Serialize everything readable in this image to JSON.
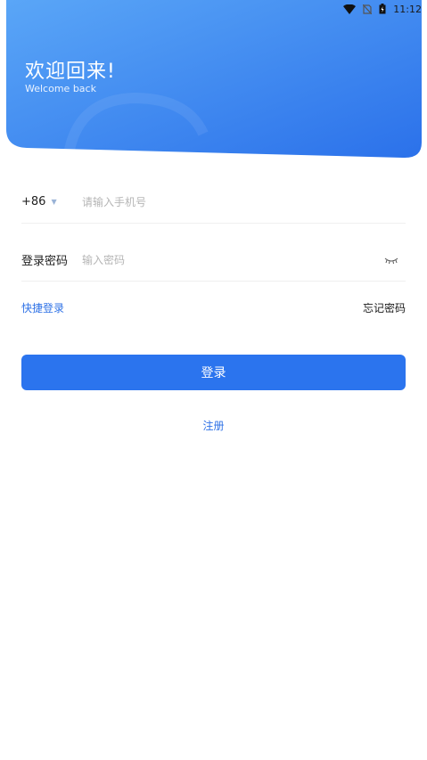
{
  "status_bar": {
    "time": "11:12",
    "icons": [
      "wifi-icon",
      "no-sim-icon",
      "battery-icon"
    ]
  },
  "header": {
    "title": "欢迎回来!",
    "subtitle": "Welcome back",
    "gradient_start": "#5aa6f7",
    "gradient_end": "#2b71ea"
  },
  "form": {
    "country_code": "+86",
    "phone_placeholder": "请输入手机号",
    "password_label": "登录密码",
    "password_placeholder": "输入密码",
    "eye_icon": "eye-closed-icon"
  },
  "links": {
    "quick_login": "快捷登录",
    "forgot_password": "忘记密码"
  },
  "actions": {
    "login": "登录",
    "register": "注册"
  },
  "colors": {
    "accent": "#2b74ee",
    "link": "#2f72e6"
  }
}
